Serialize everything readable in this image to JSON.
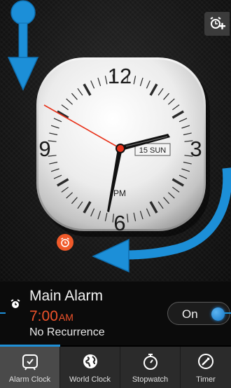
{
  "clock": {
    "numerals": {
      "n12": "12",
      "n3": "3",
      "n6": "6",
      "n9": "9"
    },
    "date_label": "15 SUN",
    "period_label": "PM"
  },
  "alarm": {
    "name": "Main Alarm",
    "time": "7:00",
    "ampm": "AM",
    "recurrence": "No Recurrence",
    "toggle_label": "On"
  },
  "tabs": [
    {
      "label": "Alarm Clock",
      "icon": "alarm-clock-icon"
    },
    {
      "label": "World Clock",
      "icon": "globe-icon"
    },
    {
      "label": "Stopwatch",
      "icon": "stopwatch-icon"
    },
    {
      "label": "Timer",
      "icon": "timer-icon"
    }
  ],
  "colors": {
    "accent_blue": "#1e8fd6",
    "alarm_orange": "#f0532b",
    "second_hand": "#e8321a"
  }
}
